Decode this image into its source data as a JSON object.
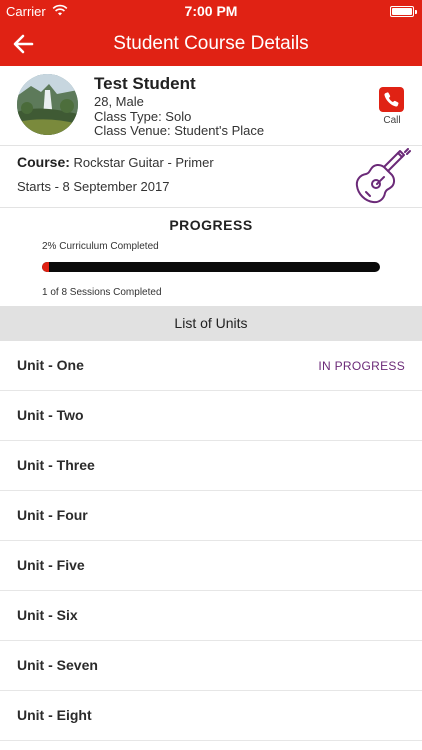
{
  "status_bar": {
    "carrier": "Carrier",
    "time": "7:00 PM",
    "wifi_icon": "wifi-icon",
    "battery_icon": "battery-icon"
  },
  "nav": {
    "title": "Student Course Details",
    "back_icon": "arrow-left-icon"
  },
  "student": {
    "name": "Test Student",
    "age_gender": "28, Male",
    "class_type": "Class Type: Solo",
    "class_venue": "Class Venue: Student's Place",
    "call_label": "Call",
    "call_icon": "phone-icon"
  },
  "course": {
    "label": "Course:",
    "name": "Rockstar Guitar - Primer",
    "starts": "Starts - 8 September 2017",
    "icon": "guitar-icon"
  },
  "progress": {
    "heading": "PROGRESS",
    "curriculum_text": "2% Curriculum Completed",
    "percent": 2,
    "sessions_text": "1 of 8 Sessions Completed"
  },
  "units_header": "List of Units",
  "units": [
    {
      "label": "Unit - One",
      "status": "IN PROGRESS"
    },
    {
      "label": "Unit - Two",
      "status": ""
    },
    {
      "label": "Unit - Three",
      "status": ""
    },
    {
      "label": "Unit - Four",
      "status": ""
    },
    {
      "label": "Unit - Five",
      "status": ""
    },
    {
      "label": "Unit - Six",
      "status": ""
    },
    {
      "label": "Unit - Seven",
      "status": ""
    },
    {
      "label": "Unit - Eight",
      "status": ""
    }
  ],
  "colors": {
    "brand_red": "#e02214",
    "status_purple": "#6b2a78",
    "section_gray": "#e1e1e1"
  }
}
